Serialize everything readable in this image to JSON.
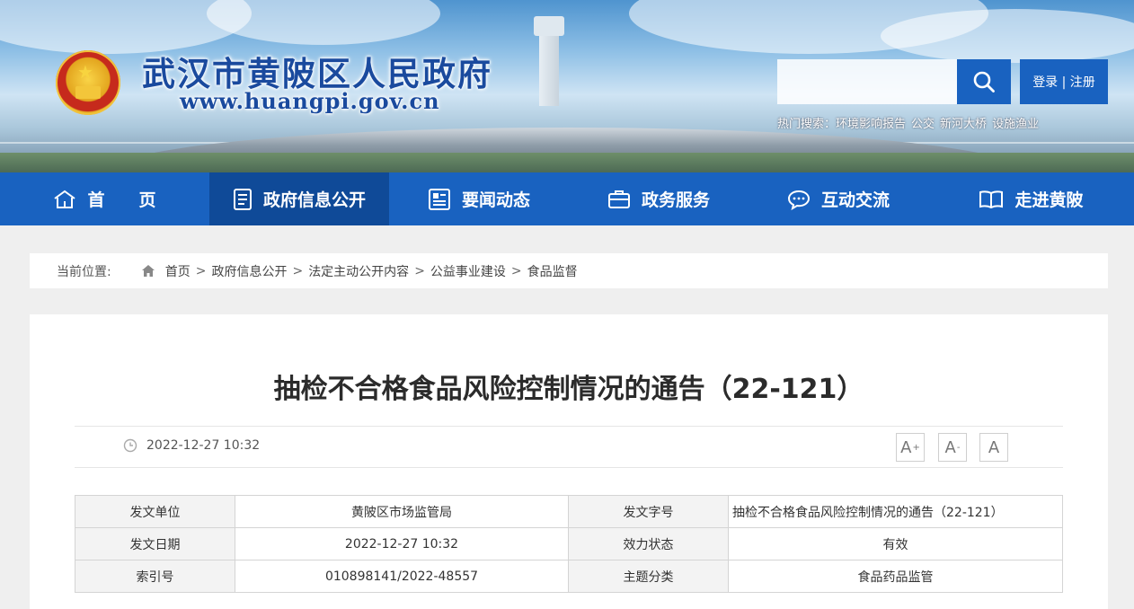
{
  "header": {
    "site_title": "武汉市黄陂区人民政府",
    "site_url": "www.huangpi.gov.cn",
    "search": {
      "value": "",
      "placeholder": ""
    },
    "login_label": "登录 | 注册",
    "hot_search_label": "热门搜索：",
    "hot_search_terms": [
      "环境影响报告",
      "公交",
      "新河大桥",
      "设施渔业"
    ],
    "brand_color": "#1962c0"
  },
  "nav": {
    "items": [
      {
        "label": "首　　页",
        "icon": "home-icon",
        "active": false
      },
      {
        "label": "政府信息公开",
        "icon": "document-list-icon",
        "active": true
      },
      {
        "label": "要闻动态",
        "icon": "news-icon",
        "active": false
      },
      {
        "label": "政务服务",
        "icon": "briefcase-icon",
        "active": false
      },
      {
        "label": "互动交流",
        "icon": "chat-bubble-icon",
        "active": false
      },
      {
        "label": "走进黄陂",
        "icon": "book-icon",
        "active": false
      }
    ]
  },
  "breadcrumb": {
    "label": "当前位置:",
    "items": [
      "首页",
      "政府信息公开",
      "法定主动公开内容",
      "公益事业建设",
      "食品监督"
    ],
    "separator": ">"
  },
  "article": {
    "title": "抽检不合格食品风险控制情况的通告（22-121）",
    "date": "2022-12-27 10:32",
    "font_controls": [
      "A+",
      "A-",
      "A"
    ]
  },
  "info_table": {
    "rows": [
      [
        "发文单位",
        "黄陂区市场监管局",
        "发文字号",
        "抽检不合格食品风险控制情况的通告（22-121）"
      ],
      [
        "发文日期",
        "2022-12-27 10:32",
        "效力状态",
        "有效"
      ],
      [
        "索引号",
        "010898141/2022-48557",
        "主题分类",
        "食品药品监管"
      ]
    ]
  }
}
